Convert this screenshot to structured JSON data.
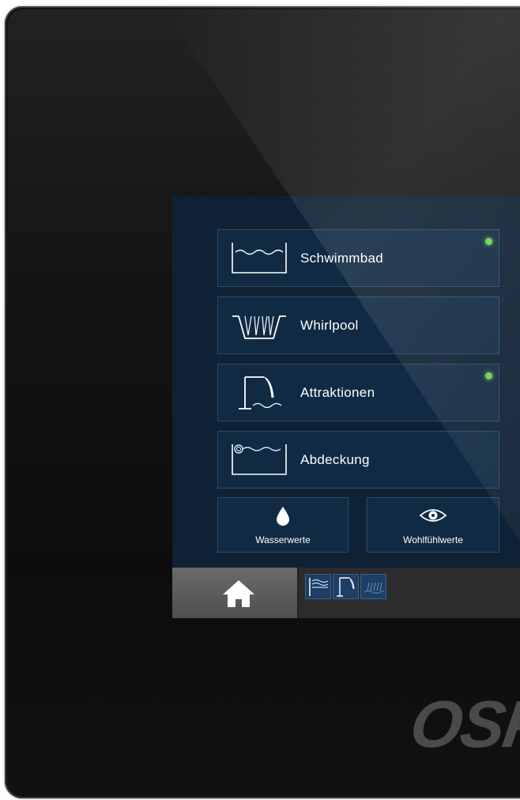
{
  "menu": {
    "items": [
      {
        "label": "Schwimmbad",
        "active": true,
        "icon": "pool-icon"
      },
      {
        "label": "Whirlpool",
        "active": false,
        "icon": "whirlpool-icon"
      },
      {
        "label": "Attraktionen",
        "active": true,
        "icon": "waterfall-icon"
      },
      {
        "label": "Abdeckung",
        "active": false,
        "icon": "pool-cover-icon"
      }
    ],
    "secondary": [
      {
        "label": "Wasserwerte",
        "icon": "water-drop-icon"
      },
      {
        "label": "Wohlfühlwerte",
        "icon": "eye-icon"
      }
    ]
  },
  "taskbar": {
    "home_icon": "home-icon",
    "quick_icons": [
      "counter-current-icon",
      "waterfall-icon",
      "massage-jets-icon"
    ]
  },
  "brand": {
    "logo_text": "OSF"
  },
  "colors": {
    "screen_bg": "#0f2134",
    "tile_bg": "#112a44",
    "status_led": "#6fd24a",
    "quick_button": "#1b3f66"
  }
}
